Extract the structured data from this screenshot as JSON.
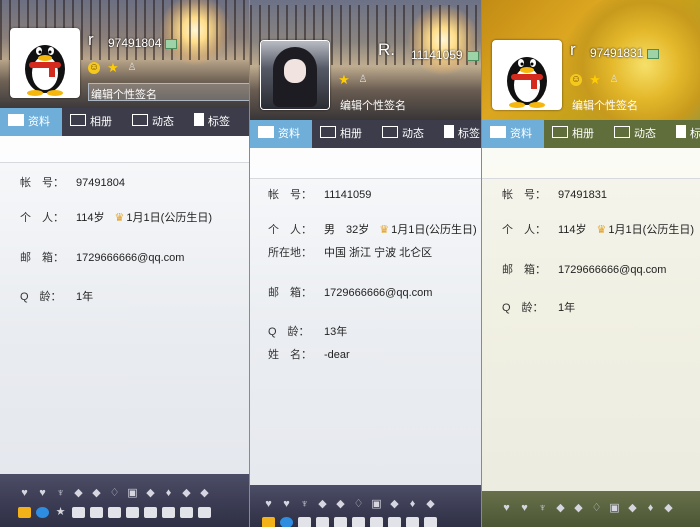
{
  "panels": [
    {
      "name": "r",
      "qq": "97491804",
      "signature": "编辑个性签名",
      "tabs": [
        "资料",
        "相册",
        "动态",
        "标签"
      ],
      "profile": [
        {
          "label": "帐　号：",
          "value": "97491804"
        },
        {
          "label": "个　人：",
          "value": "114岁",
          "birthday": "1月1日(公历生日)"
        },
        {
          "label": "邮　箱：",
          "value": "1729666666@qq.com"
        },
        {
          "label": "Q　龄：",
          "value": "1年"
        }
      ]
    },
    {
      "name": "R.",
      "qq": "11141059",
      "signature": "编辑个性签名",
      "tabs": [
        "资料",
        "相册",
        "动态",
        "标签"
      ],
      "profile": [
        {
          "label": "帐　号：",
          "value": "11141059"
        },
        {
          "label": "个　人：",
          "value": "男　32岁",
          "birthday": "1月1日(公历生日)"
        },
        {
          "label": "所在地：",
          "value": "中国 浙江 宁波 北仑区"
        },
        {
          "label": "邮　箱：",
          "value": "1729666666@qq.com"
        },
        {
          "label": "Q　龄：",
          "value": "13年"
        },
        {
          "label": "姓　名：",
          "value": "-dear"
        }
      ]
    },
    {
      "name": "r",
      "qq": "97491831",
      "signature": "编辑个性签名",
      "tabs": [
        "资料",
        "相册",
        "动态",
        "标签"
      ],
      "profile": [
        {
          "label": "帐　号：",
          "value": "97491831"
        },
        {
          "label": "个　人：",
          "value": "114岁",
          "birthday": "1月1日(公历生日)"
        },
        {
          "label": "邮　箱：",
          "value": "1729666666@qq.com"
        },
        {
          "label": "Q　龄：",
          "value": "1年"
        }
      ]
    }
  ],
  "icons": {
    "penguin": "qq-penguin-avatar",
    "crown": "♛",
    "active_tab_color": "#6eaed9"
  }
}
